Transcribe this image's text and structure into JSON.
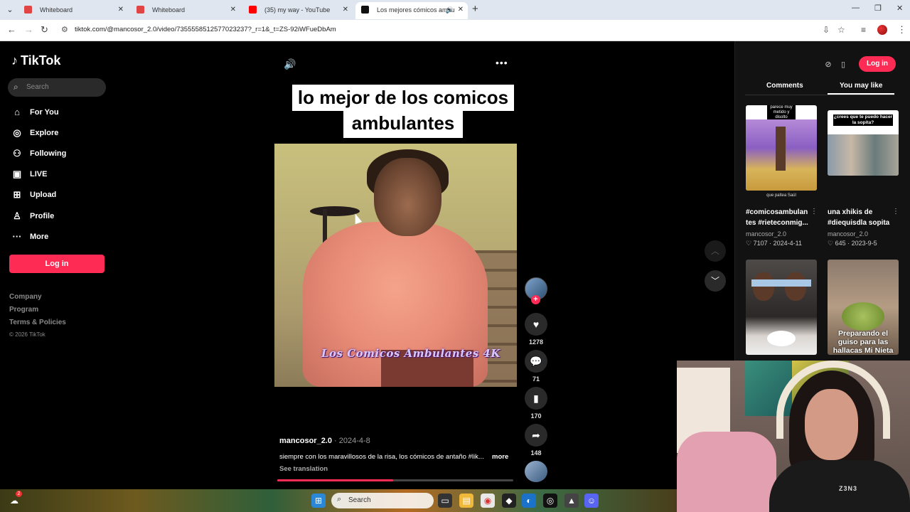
{
  "browser": {
    "tabs": [
      {
        "title": "Whiteboard",
        "favicon_color": "#e04444",
        "active": false
      },
      {
        "title": "Whiteboard",
        "favicon_color": "#e04444",
        "active": false
      },
      {
        "title": "(35) my way - YouTube",
        "favicon_color": "#ff0000",
        "active": false
      },
      {
        "title": "Los mejores cómicos ambu",
        "favicon_color": "#111111",
        "active": true
      }
    ],
    "url": "tiktok.com/@mancosor_2.0/video/7355558512577023237?_r=1&_t=ZS-92iWFueDbAm"
  },
  "sidebar": {
    "logo": "TikTok",
    "search_placeholder": "Search",
    "nav": [
      {
        "label": "For You",
        "icon": "home-icon",
        "glyph": "⌂"
      },
      {
        "label": "Explore",
        "icon": "compass-icon",
        "glyph": "◎"
      },
      {
        "label": "Following",
        "icon": "users-icon",
        "glyph": "⚇"
      },
      {
        "label": "LIVE",
        "icon": "live-icon",
        "glyph": "▣"
      },
      {
        "label": "Upload",
        "icon": "upload-icon",
        "glyph": "⊞"
      },
      {
        "label": "Profile",
        "icon": "profile-icon",
        "glyph": "♙"
      },
      {
        "label": "More",
        "icon": "more-icon",
        "glyph": "···"
      }
    ],
    "login_label": "Log in",
    "footer_links": [
      "Company",
      "Program",
      "Terms & Policies"
    ],
    "copyright": "© 2026 TikTok"
  },
  "video": {
    "caption_line1": "lo mejor de los comicos",
    "caption_line2": "ambulantes",
    "watermark": "Los Comicos Ambulantes 4K",
    "author": "mancosor_2.0",
    "date": "· 2024-4-8",
    "description": "siempre con los maravillosos de la risa, los cómicos de antaño #lik...",
    "more_label": "more",
    "see_translation": "See translation",
    "progress": 0.49,
    "likes": "1278",
    "comments": "71",
    "saves": "170",
    "shares": "148"
  },
  "right_panel": {
    "login_label": "Log in",
    "tab_comments": "Comments",
    "tab_you_may_like": "You may like",
    "items": [
      {
        "caption_line1": "#comicosambulan",
        "caption_line2": "tes #rieteconmig...",
        "author": "mancosor_2.0",
        "likes": "7107",
        "date": "· 2024-4-11",
        "thumb_top": "parece muy metido y disolto",
        "thumb_bottom": "que paltea Saúl"
      },
      {
        "caption_line1": "una xhikis de",
        "caption_line2": "#diequisdla sopita",
        "author": "mancosor_2.0",
        "likes": "645",
        "date": "· 2023-9-5",
        "thumb_top": "¿crees que te puedo hacer la sopita?"
      },
      {
        "thumb_text": ""
      },
      {
        "thumb_text": "Preparando el guiso para las hallacas Mi Nieta"
      }
    ]
  },
  "webcam": {
    "shirt_text": "Z3N3"
  },
  "taskbar": {
    "search_placeholder": "Search",
    "notification_count": "2"
  }
}
